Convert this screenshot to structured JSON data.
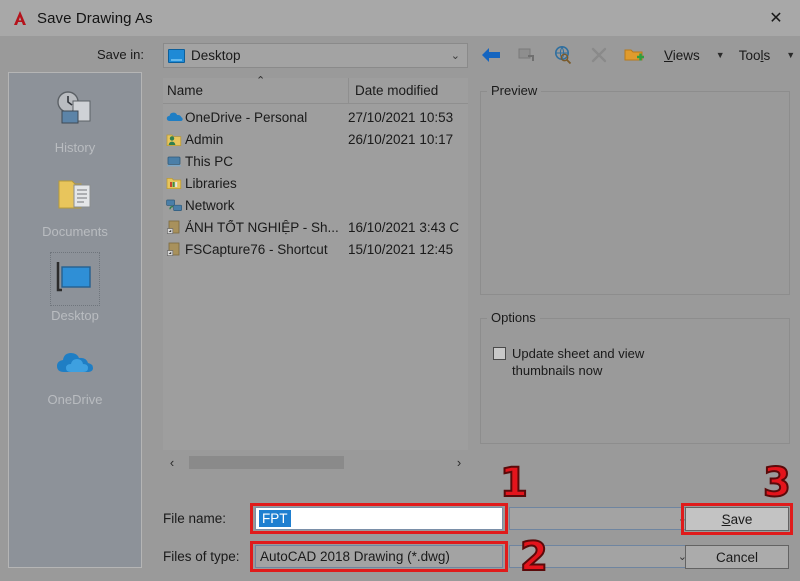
{
  "window": {
    "title": "Save Drawing As",
    "logo_icon": "autocad-a-logo",
    "close_icon": "close-icon"
  },
  "savein": {
    "label": "Save in:",
    "value": "Desktop",
    "icon": "desktop-monitor-icon",
    "caret": "⌄"
  },
  "toolbar": {
    "back_icon": "back-arrow-icon",
    "up_icon": "up-one-level-icon",
    "search_icon": "search-web-icon",
    "delete_icon": "delete-x-icon",
    "newfolder_icon": "new-folder-icon",
    "views_label": "Views",
    "tools_label": "Tools",
    "caret": "▼"
  },
  "places": {
    "items": [
      {
        "label": "History",
        "icon": "history-clock-icon",
        "selected": false
      },
      {
        "label": "Documents",
        "icon": "documents-folder-icon",
        "selected": false
      },
      {
        "label": "Desktop",
        "icon": "desktop-monitor-icon",
        "selected": true
      },
      {
        "label": "OneDrive",
        "icon": "onedrive-cloud-icon",
        "selected": false
      }
    ]
  },
  "filelist": {
    "columns": {
      "name": "Name",
      "date": "Date modified"
    },
    "sort_indicator": "⌃",
    "rows": [
      {
        "name": "OneDrive - Personal",
        "date": "27/10/2021 10:53",
        "icon": "cloud-icon"
      },
      {
        "name": "Admin",
        "date": "26/10/2021 10:17",
        "icon": "user-folder-icon"
      },
      {
        "name": "This PC",
        "date": "",
        "icon": "this-pc-icon"
      },
      {
        "name": "Libraries",
        "date": "",
        "icon": "libraries-folder-icon"
      },
      {
        "name": "Network",
        "date": "",
        "icon": "network-icon"
      },
      {
        "name": "ẢNH TỐT NGHIỆP - Sh...",
        "date": "16/10/2021 3:43 C",
        "icon": "shortcut-icon"
      },
      {
        "name": "FSCapture76 - Shortcut",
        "date": "15/10/2021 12:45",
        "icon": "shortcut-icon"
      }
    ],
    "scrollbar": {
      "left_arrow": "‹",
      "right_arrow": "›"
    }
  },
  "preview": {
    "label": "Preview"
  },
  "options": {
    "label": "Options",
    "checkbox_label": "Update sheet and view thumbnails now",
    "checked": false
  },
  "form": {
    "filename_label": "File name:",
    "filename_value": "FPT",
    "filetype_label": "Files of type:",
    "filetype_value": "AutoCAD 2018 Drawing (*.dwg)",
    "combo_caret": "⌄",
    "empty_combo_value": ""
  },
  "buttons": {
    "save": "Save",
    "cancel": "Cancel"
  },
  "annotations": {
    "marker1": "1",
    "marker2": "2",
    "marker3": "3",
    "highlight_color": "#e01b1b",
    "number_color": "#e4141c"
  }
}
